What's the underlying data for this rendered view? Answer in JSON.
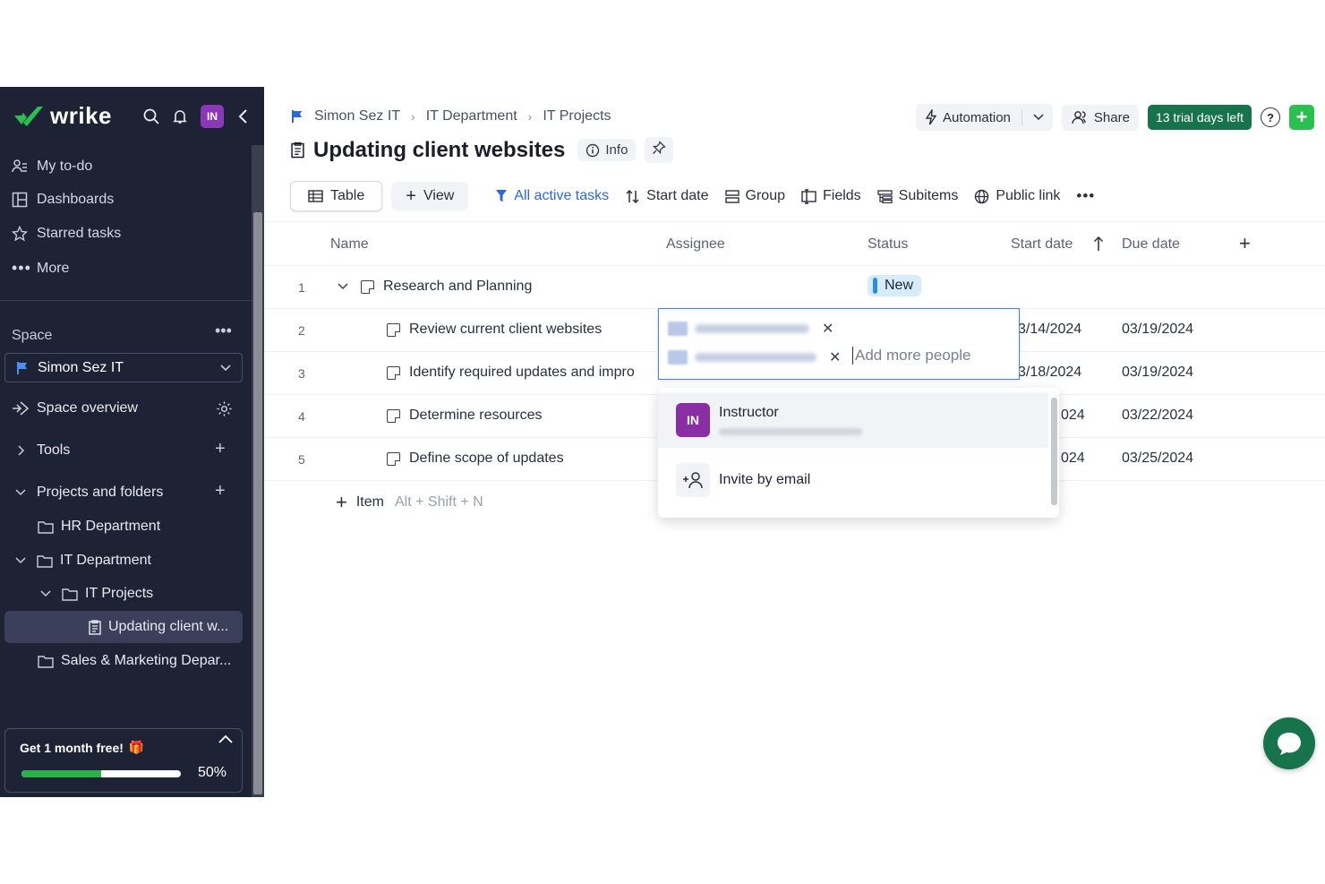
{
  "sidebar": {
    "brand": "wrike",
    "avatar_initials": "IN",
    "nav": [
      {
        "label": "My to-do",
        "icon": "person-list-icon"
      },
      {
        "label": "Dashboards",
        "icon": "dashboard-icon"
      },
      {
        "label": "Starred tasks",
        "icon": "star-icon"
      },
      {
        "label": "More",
        "icon": "ellipsis-icon"
      }
    ],
    "space_label": "Space",
    "space_selected": "Simon Sez IT",
    "space_overview": "Space overview",
    "tools": "Tools",
    "projects_folders": "Projects and folders",
    "tree": [
      {
        "label": "HR Department"
      },
      {
        "label": "IT Department"
      },
      {
        "label": "IT Projects"
      },
      {
        "label": "Updating client w..."
      },
      {
        "label": "Sales & Marketing Depar..."
      }
    ],
    "promo": {
      "title": "Get 1 month free!",
      "progress_text": "50%",
      "progress": 0.5
    }
  },
  "breadcrumb": [
    "Simon Sez IT",
    "IT Department",
    "IT Projects"
  ],
  "page_title": "Updating client websites",
  "info_label": "Info",
  "top_actions": {
    "automation": "Automation",
    "share": "Share",
    "trial": "13 trial days left",
    "help": "?"
  },
  "toolbar": {
    "table": "Table",
    "view": "View",
    "filter": "All active tasks",
    "sort": "Start date",
    "group": "Group",
    "fields": "Fields",
    "subitems": "Subitems",
    "public_link": "Public link"
  },
  "columns": {
    "name": "Name",
    "assignee": "Assignee",
    "status": "Status",
    "start_date": "Start date",
    "due_date": "Due date"
  },
  "rows": [
    {
      "num": "1",
      "name": "Research and Planning",
      "status": "New",
      "start": "",
      "due": ""
    },
    {
      "num": "2",
      "name": "Review current client websites",
      "start": "3/14/2024",
      "due": "03/19/2024"
    },
    {
      "num": "3",
      "name": "Identify required updates and impro",
      "start": "3/18/2024",
      "due": "03/19/2024"
    },
    {
      "num": "4",
      "name": "Determine resources",
      "start": "024",
      "due": "03/22/2024"
    },
    {
      "num": "5",
      "name": "Define scope of updates",
      "start": "024",
      "due": "03/25/2024"
    }
  ],
  "add_item": {
    "label": "Item",
    "shortcut": "Alt + Shift + N"
  },
  "assignee_popup": {
    "placeholder": "Add more people",
    "options": [
      {
        "name": "Instructor",
        "initials": "IN"
      },
      {
        "name": "Invite by email"
      }
    ]
  },
  "colors": {
    "sidebar_bg": "#1e2235",
    "accent_blue": "#2e68d8",
    "trial_green": "#17734b",
    "plus_green": "#2bbf4f",
    "avatar_purple": "#8a37b8",
    "status_new": "#d6ecf8"
  }
}
